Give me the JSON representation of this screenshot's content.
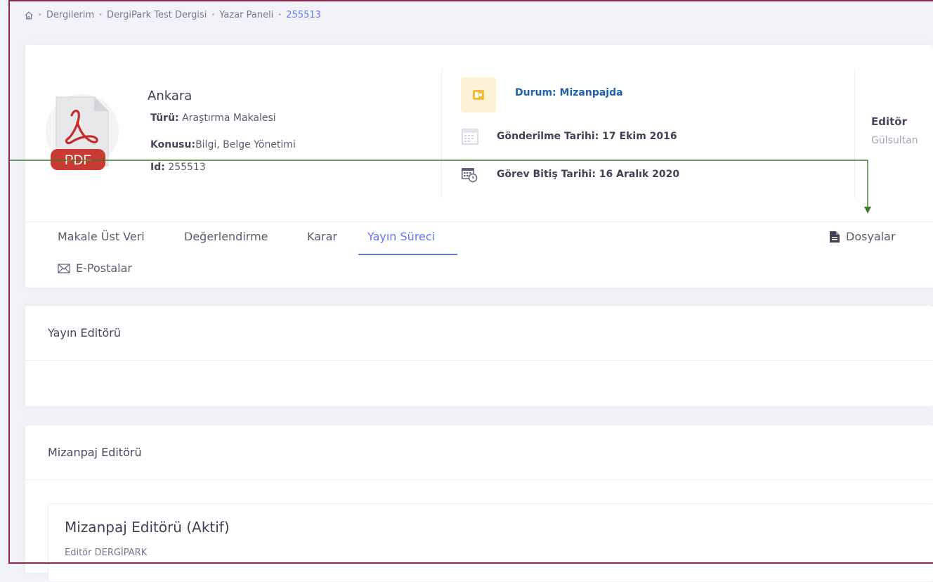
{
  "breadcrumb": {
    "items": [
      "Dergilerim",
      "DergiPark Test Dergisi",
      "Yazar Paneli"
    ],
    "current": "255513"
  },
  "article": {
    "title": "Ankara",
    "type_label": "Türü:",
    "type_value": "Araştırma Makalesi",
    "subject_label": "Konusu:",
    "subject_value": "Bilgi, Belge Yönetimi",
    "id_label": "Id:",
    "id_value": "255513",
    "pdf_badge": "PDF"
  },
  "status": {
    "text": "Durum: Mizanpajda",
    "submitted": "Gönderilme Tarihi: 17 Ekim 2016",
    "due": "Görev Bitiş Tarihi: 16 Aralık 2020"
  },
  "editor": {
    "label": "Editör",
    "name": "Gülsultan"
  },
  "tabs": {
    "metadata": "Makale Üst Veri",
    "review": "Değerlendirme",
    "decision": "Karar",
    "publication": "Yayın Süreci",
    "files": "Dosyalar",
    "emails": "E-Postalar"
  },
  "sections": {
    "publication_editor": "Yayın Editörü",
    "layout_editor": "Mizanpaj Editörü",
    "layout_editor_active": "Mizanpaj Editörü (Aktif)",
    "layout_editor_name": "Editör DERGİPARK"
  },
  "colors": {
    "accent": "#5d78ff",
    "status_blue": "#1f5fa8",
    "status_bg": "#fdf1d6",
    "arrow": "#3a7d1e",
    "frame": "#8b2a4f"
  }
}
